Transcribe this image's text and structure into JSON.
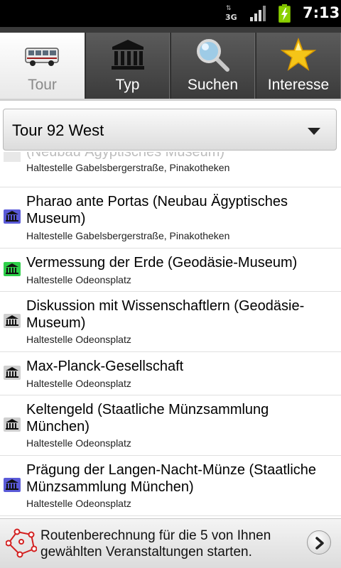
{
  "status_bar": {
    "network": "3G",
    "time": "7:13"
  },
  "tabs": [
    {
      "label": "Tour",
      "icon": "bus-icon",
      "active": true
    },
    {
      "label": "Typ",
      "icon": "museum-icon",
      "active": false
    },
    {
      "label": "Suchen",
      "icon": "search-icon",
      "active": false
    },
    {
      "label": "Interesse",
      "icon": "star-icon",
      "active": false
    }
  ],
  "spinner": {
    "selected": "Tour 92 West"
  },
  "list": {
    "items": [
      {
        "title": "(Neubau Ägyptisches Museum)",
        "subtitle": "Haltestelle Gabelsbergerstraße, Pinakotheken",
        "icon_color": "#dddddd"
      },
      {
        "title": "Pharao ante Portas (Neubau Ägyptisches Museum)",
        "subtitle": "Haltestelle Gabelsbergerstraße, Pinakotheken",
        "icon_color": "#5a5ad8"
      },
      {
        "title": "Vermessung der Erde (Geodäsie-Museum)",
        "subtitle": "Haltestelle Odeonsplatz",
        "icon_color": "#2ecf4a"
      },
      {
        "title": "Diskussion mit Wissenschaftlern (Geodäsie-Museum)",
        "subtitle": "Haltestelle Odeonsplatz",
        "icon_color": "#9e9e9e"
      },
      {
        "title": "Max-Planck-Gesellschaft",
        "subtitle": "Haltestelle Odeonsplatz",
        "icon_color": "#9e9e9e"
      },
      {
        "title": "Keltengeld (Staatliche Münzsammlung München)",
        "subtitle": "Haltestelle Odeonsplatz",
        "icon_color": "#9e9e9e"
      },
      {
        "title": "Prägung der Langen-Nacht-Münze (Staatliche Münzsammlung München)",
        "subtitle": "Haltestelle Odeonsplatz",
        "icon_color": "#5a5ad8"
      }
    ]
  },
  "bottom_bar": {
    "text": "Routenberechnung für die 5 von Ihnen gewählten Veranstaltungen starten.",
    "icon": "route-icon",
    "button_icon": "chevron-right-icon"
  },
  "colors": {
    "tab_bg": "#4a4a4a",
    "active_tab_bg": "#f2f2f2",
    "museum_blue": "#5a5ad8",
    "museum_green": "#2ecf4a",
    "museum_gray": "#9e9e9e",
    "route_red": "#d32020"
  }
}
